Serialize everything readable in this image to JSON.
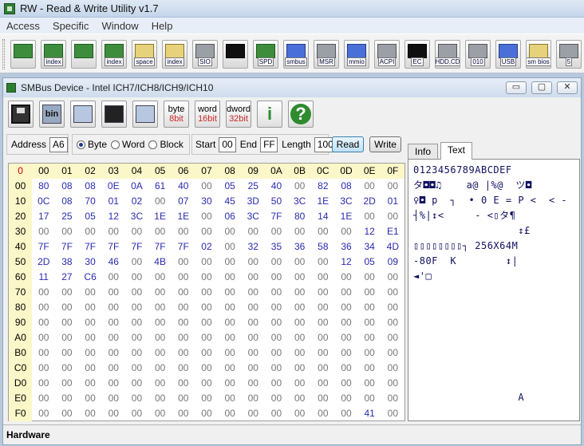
{
  "app": {
    "title": "RW - Read & Write Utility v1.7"
  },
  "menu": [
    "Access",
    "Specific",
    "Window",
    "Help"
  ],
  "toolbar": [
    {
      "label": "",
      "icon": "pci-card-icon",
      "color": "green"
    },
    {
      "label": "index",
      "icon": "index-card-icon",
      "color": "green"
    },
    {
      "label": "",
      "icon": "memory-chip-icon",
      "color": "green"
    },
    {
      "label": "index",
      "icon": "index-memory-icon",
      "color": "green"
    },
    {
      "label": "space",
      "icon": "io-space-icon",
      "color": "yellow"
    },
    {
      "label": "index",
      "icon": "io-index-icon",
      "color": "yellow"
    },
    {
      "label": "SIO",
      "icon": "superio-icon",
      "color": "gray"
    },
    {
      "label": "",
      "icon": "oscilloscope-icon",
      "color": "dark"
    },
    {
      "label": "SPD",
      "icon": "spd-icon",
      "color": "green"
    },
    {
      "label": "smbus",
      "icon": "smbus-icon",
      "color": "blue"
    },
    {
      "label": "MSR",
      "icon": "msr-icon",
      "color": "gray"
    },
    {
      "label": "mmio",
      "icon": "mmio-icon",
      "color": "blue"
    },
    {
      "label": "ACPI",
      "icon": "acpi-icon",
      "color": "gray"
    },
    {
      "label": "EC",
      "icon": "ec-icon",
      "color": "dark"
    },
    {
      "label": "HDD,CD",
      "icon": "hdd-cd-icon",
      "color": "gray"
    },
    {
      "label": "010",
      "icon": "disk-raw-icon",
      "color": "gray"
    },
    {
      "label": "USB",
      "icon": "usb-icon",
      "color": "blue"
    },
    {
      "label": "sm bios",
      "icon": "smbios-icon",
      "color": "yellow"
    },
    {
      "label": "5",
      "icon": "more-icon",
      "color": "gray"
    }
  ],
  "child": {
    "title": "SMBus Device - Intel ICH7/ICH8/ICH9/ICH10",
    "buttons": {
      "min": "▭",
      "max": "▢",
      "close": "✕"
    },
    "tools": [
      {
        "icon": "save-icon",
        "text": ""
      },
      {
        "icon": "bin-file-icon",
        "text": "bin"
      },
      {
        "icon": "copy-icon",
        "text": ""
      },
      {
        "icon": "binoculars-icon",
        "text": ""
      },
      {
        "icon": "table-icon",
        "text": ""
      },
      {
        "icon": "byte-8bit-icon",
        "text": "byte",
        "sub": "8bit"
      },
      {
        "icon": "word-16bit-icon",
        "text": "word",
        "sub": "16bit"
      },
      {
        "icon": "dword-32bit-icon",
        "text": "dword",
        "sub": "32bit"
      },
      {
        "icon": "info-icon",
        "text": "i"
      },
      {
        "icon": "help-icon",
        "text": "?"
      }
    ],
    "address_label": "Address",
    "address_value": "A6",
    "mode": {
      "byte": "Byte",
      "word": "Word",
      "block": "Block",
      "selected": "Byte"
    },
    "start_label": "Start",
    "start_value": "00",
    "end_label": "End",
    "end_value": "FF",
    "length_label": "Length",
    "length_value": "100",
    "read_label": "Read",
    "write_label": "Write",
    "tabs": [
      "Info",
      "Text"
    ],
    "selected_tab": "Text",
    "grid": {
      "col_headers": [
        "0",
        "00",
        "01",
        "02",
        "03",
        "04",
        "05",
        "06",
        "07",
        "08",
        "09",
        "0A",
        "0B",
        "0C",
        "0D",
        "0E",
        "0F"
      ],
      "rows": [
        {
          "h": "00",
          "v": [
            "80",
            "08",
            "08",
            "0E",
            "0A",
            "61",
            "40",
            "00",
            "05",
            "25",
            "40",
            "00",
            "82",
            "08",
            "00",
            "00"
          ]
        },
        {
          "h": "10",
          "v": [
            "0C",
            "08",
            "70",
            "01",
            "02",
            "00",
            "07",
            "30",
            "45",
            "3D",
            "50",
            "3C",
            "1E",
            "3C",
            "2D",
            "01"
          ]
        },
        {
          "h": "20",
          "v": [
            "17",
            "25",
            "05",
            "12",
            "3C",
            "1E",
            "1E",
            "00",
            "06",
            "3C",
            "7F",
            "80",
            "14",
            "1E",
            "00",
            "00"
          ]
        },
        {
          "h": "30",
          "v": [
            "00",
            "00",
            "00",
            "00",
            "00",
            "00",
            "00",
            "00",
            "00",
            "00",
            "00",
            "00",
            "00",
            "00",
            "12",
            "E1"
          ]
        },
        {
          "h": "40",
          "v": [
            "7F",
            "7F",
            "7F",
            "7F",
            "7F",
            "7F",
            "7F",
            "02",
            "00",
            "32",
            "35",
            "36",
            "58",
            "36",
            "34",
            "4D"
          ]
        },
        {
          "h": "50",
          "v": [
            "2D",
            "38",
            "30",
            "46",
            "00",
            "4B",
            "00",
            "00",
            "00",
            "00",
            "00",
            "00",
            "00",
            "12",
            "05",
            "09"
          ]
        },
        {
          "h": "60",
          "v": [
            "11",
            "27",
            "C6",
            "00",
            "00",
            "00",
            "00",
            "00",
            "00",
            "00",
            "00",
            "00",
            "00",
            "00",
            "00",
            "00"
          ]
        },
        {
          "h": "70",
          "v": [
            "00",
            "00",
            "00",
            "00",
            "00",
            "00",
            "00",
            "00",
            "00",
            "00",
            "00",
            "00",
            "00",
            "00",
            "00",
            "00"
          ]
        },
        {
          "h": "80",
          "v": [
            "00",
            "00",
            "00",
            "00",
            "00",
            "00",
            "00",
            "00",
            "00",
            "00",
            "00",
            "00",
            "00",
            "00",
            "00",
            "00"
          ]
        },
        {
          "h": "90",
          "v": [
            "00",
            "00",
            "00",
            "00",
            "00",
            "00",
            "00",
            "00",
            "00",
            "00",
            "00",
            "00",
            "00",
            "00",
            "00",
            "00"
          ]
        },
        {
          "h": "A0",
          "v": [
            "00",
            "00",
            "00",
            "00",
            "00",
            "00",
            "00",
            "00",
            "00",
            "00",
            "00",
            "00",
            "00",
            "00",
            "00",
            "00"
          ]
        },
        {
          "h": "B0",
          "v": [
            "00",
            "00",
            "00",
            "00",
            "00",
            "00",
            "00",
            "00",
            "00",
            "00",
            "00",
            "00",
            "00",
            "00",
            "00",
            "00"
          ]
        },
        {
          "h": "C0",
          "v": [
            "00",
            "00",
            "00",
            "00",
            "00",
            "00",
            "00",
            "00",
            "00",
            "00",
            "00",
            "00",
            "00",
            "00",
            "00",
            "00"
          ]
        },
        {
          "h": "D0",
          "v": [
            "00",
            "00",
            "00",
            "00",
            "00",
            "00",
            "00",
            "00",
            "00",
            "00",
            "00",
            "00",
            "00",
            "00",
            "00",
            "00"
          ]
        },
        {
          "h": "E0",
          "v": [
            "00",
            "00",
            "00",
            "00",
            "00",
            "00",
            "00",
            "00",
            "00",
            "00",
            "00",
            "00",
            "00",
            "00",
            "00",
            "00"
          ]
        },
        {
          "h": "F0",
          "v": [
            "00",
            "00",
            "00",
            "00",
            "00",
            "00",
            "00",
            "00",
            "00",
            "00",
            "00",
            "00",
            "00",
            "00",
            "41",
            "00"
          ]
        }
      ]
    },
    "text_panel": [
      "0123456789ABCDEF",
      "タ◘◘♫    a@ |%@  ツ◘",
      "♀◘ p  ┐  • 0 E = P <  < -",
      "┤%|↕<     - <▯タ¶",
      "                 ↕£",
      "▯▯▯▯▯▯▯▯┐ 256X64M",
      "-80F  K        ↕|",
      "◄'□",
      "",
      "",
      "",
      "",
      "",
      "",
      "",
      "                 A"
    ],
    "status": "Hardware"
  }
}
